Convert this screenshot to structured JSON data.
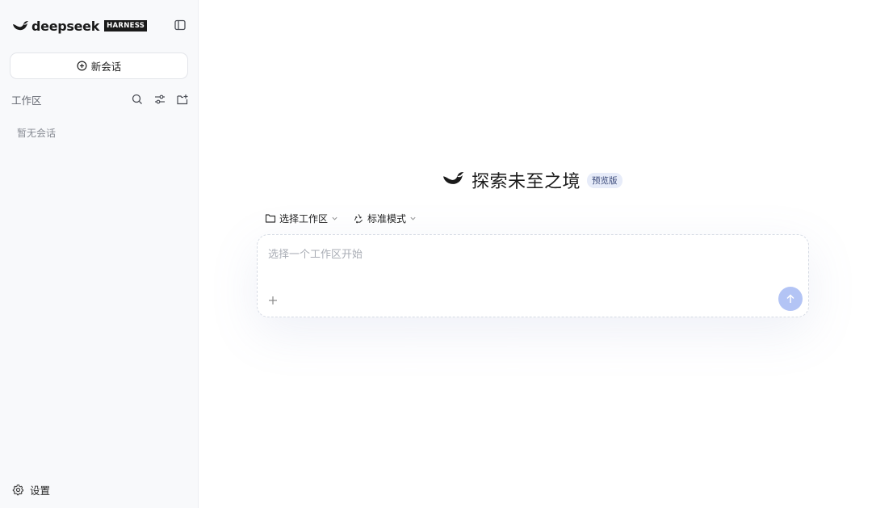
{
  "brand": {
    "name": "deepseek",
    "tag": "HARNESS"
  },
  "sidebar": {
    "new_chat_label": "新会话",
    "workspace_label": "工作区",
    "empty_text": "暂无会话",
    "settings_label": "设置"
  },
  "main": {
    "title": "探索未至之境",
    "badge": "预览版",
    "workspace_select_label": "选择工作区",
    "mode_label": "标准模式",
    "input_placeholder": "选择一个工作区开始"
  },
  "colors": {
    "accent": "#b3c4f5",
    "badge_bg": "#e7ecf9",
    "sidebar_bg": "#f8f9fb"
  },
  "icons": {
    "logo": "whale-logo-icon",
    "collapse": "sidebar-toggle-icon",
    "new_chat": "plus-circle-icon",
    "search": "search-icon",
    "filter": "sliders-icon",
    "new_folder": "folder-add-icon",
    "settings": "gear-icon",
    "folder": "folder-icon",
    "mode": "recycle-icon",
    "chevron": "chevron-down-icon",
    "attach": "plus-icon",
    "send": "arrow-up-icon"
  }
}
